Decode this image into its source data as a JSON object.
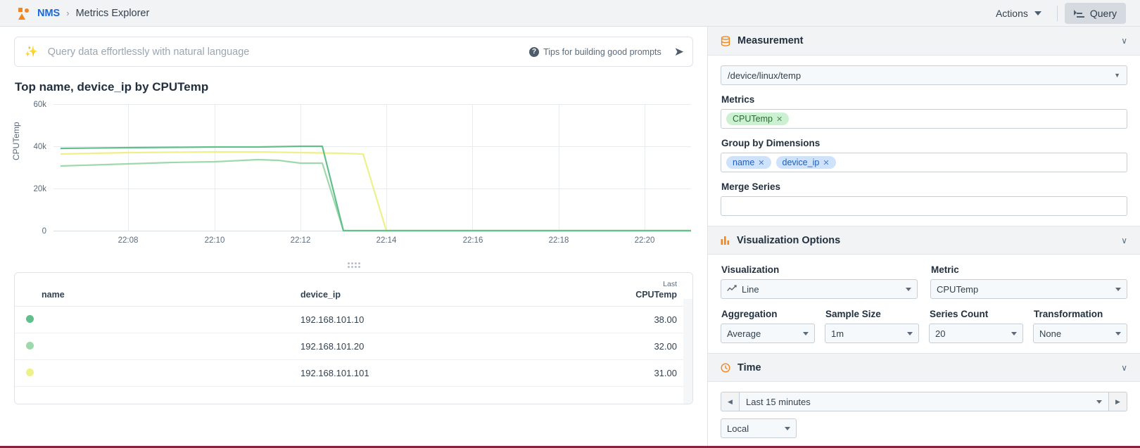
{
  "topbar": {
    "logo_icon": "nms-logo-icon",
    "breadcrumb_root": "NMS",
    "breadcrumb_sep": "›",
    "breadcrumb_current": "Metrics Explorer",
    "actions_label": "Actions",
    "query_label": "Query"
  },
  "nl_query": {
    "sparkle_icon": "sparkle-icon",
    "value": "",
    "placeholder": "Query data effortlessly with natural language",
    "tips_label": "Tips for building good prompts",
    "help_icon_glyph": "?",
    "send_icon": "send-icon",
    "send_glyph": "➤"
  },
  "chart": {
    "title": "Top name, device_ip by CPUTemp"
  },
  "chart_data": {
    "type": "line",
    "title": "Top name, device_ip by CPUTemp",
    "xlabel": "",
    "ylabel": "CPUTemp",
    "ylim": [
      0,
      60000
    ],
    "yticks": [
      0,
      20000,
      40000,
      60000
    ],
    "ytick_labels": [
      "0",
      "20k",
      "40k",
      "60k"
    ],
    "x": [
      "22:07",
      "22:08",
      "22:09",
      "22:10",
      "22:11",
      "22:12",
      "22:13",
      "22:14",
      "22:15",
      "22:16",
      "22:17",
      "22:18",
      "22:19",
      "22:20",
      "22:21"
    ],
    "xticks": [
      "22:08",
      "22:10",
      "22:12",
      "22:14",
      "22:16",
      "22:18",
      "22:20"
    ],
    "grid": true,
    "legend": "none",
    "series": [
      {
        "name": "192.168.101.10",
        "color": "#62bf8d",
        "values": [
          39000,
          39000,
          39100,
          39200,
          39300,
          0,
          0,
          0,
          0,
          0,
          0,
          0,
          0,
          0,
          0
        ]
      },
      {
        "name": "192.168.101.20",
        "color": "#9fd9ab",
        "values": [
          31000,
          31400,
          32000,
          32400,
          33200,
          32000,
          32000,
          0,
          0,
          0,
          0,
          0,
          0,
          0,
          0
        ]
      },
      {
        "name": "192.168.101.101",
        "color": "#eef08a",
        "values": [
          36200,
          36600,
          36800,
          36800,
          36700,
          36600,
          36500,
          36400,
          0,
          0,
          0,
          0,
          0,
          0,
          0
        ]
      }
    ]
  },
  "table": {
    "columns": [
      {
        "key": "name",
        "label": "name",
        "sub": ""
      },
      {
        "key": "device_ip",
        "label": "device_ip",
        "sub": ""
      },
      {
        "key": "value",
        "label": "CPUTemp",
        "sub": "Last"
      }
    ],
    "rows": [
      {
        "swatch": "#62bf8d",
        "name": "",
        "device_ip": "192.168.101.10",
        "value": "38.00"
      },
      {
        "swatch": "#9fd9ab",
        "name": "",
        "device_ip": "192.168.101.20",
        "value": "32.00"
      },
      {
        "swatch": "#eef08a",
        "name": "",
        "device_ip": "192.168.101.101",
        "value": "31.00"
      }
    ]
  },
  "panel": {
    "measurement": {
      "icon": "database-icon",
      "title": "Measurement",
      "chevron": "∨",
      "path_value": "/device/linux/temp",
      "metrics_label": "Metrics",
      "metrics_tags": [
        "CPUTemp"
      ],
      "groupby_label": "Group by Dimensions",
      "groupby_tags": [
        "name",
        "device_ip"
      ],
      "merge_label": "Merge Series",
      "merge_value": ""
    },
    "visualization": {
      "icon": "bar-chart-icon",
      "title": "Visualization Options",
      "chevron": "∨",
      "visualization_label": "Visualization",
      "visualization_value": "Line",
      "visualization_icon": "line-chart-icon",
      "metric_label": "Metric",
      "metric_value": "CPUTemp",
      "aggregation_label": "Aggregation",
      "aggregation_value": "Average",
      "sample_size_label": "Sample Size",
      "sample_size_value": "1m",
      "series_count_label": "Series Count",
      "series_count_value": "20",
      "transformation_label": "Transformation",
      "transformation_value": "None"
    },
    "time": {
      "icon": "clock-icon",
      "title": "Time",
      "chevron": "∨",
      "prev_glyph": "◀",
      "next_glyph": "▶",
      "range_value": "Last 15 minutes",
      "timezone_value": "Local"
    }
  },
  "colors": {
    "accent_orange": "#f3871f",
    "link_blue": "#1769e0",
    "panel_bg": "#f1f3f5"
  }
}
